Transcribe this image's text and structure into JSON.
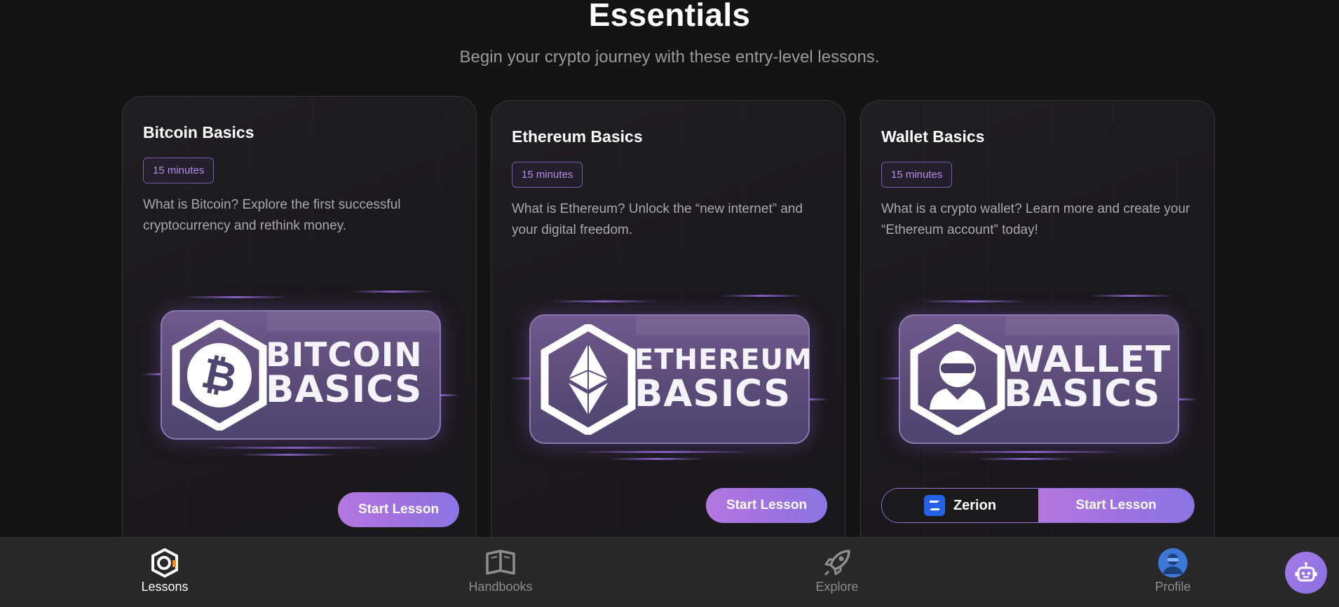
{
  "header": {
    "title": "Essentials",
    "subtitle": "Begin your crypto journey with these entry-level lessons."
  },
  "cards": [
    {
      "title": "Bitcoin Basics",
      "duration": "15 minutes",
      "description": "What is Bitcoin? Explore the first successful cryptocurrency and rethink money.",
      "banner_line1": "BITCOIN",
      "banner_line2": "BASICS",
      "banner_icon": "bitcoin-icon",
      "start_label": "Start Lesson"
    },
    {
      "title": "Ethereum Basics",
      "duration": "15 minutes",
      "description": "What is Ethereum? Unlock the “new internet” and your digital freedom.",
      "banner_line1": "ETHEREUM",
      "banner_line2": "BASICS",
      "banner_icon": "ethereum-icon",
      "start_label": "Start Lesson"
    },
    {
      "title": "Wallet Basics",
      "duration": "15 minutes",
      "description": "What is a crypto wallet? Learn more and create your “Ethereum account” today!",
      "banner_line1": "WALLET",
      "banner_line2": "BASICS",
      "banner_icon": "wallet-user-icon",
      "wallet_label": "Zerion",
      "start_label": "Start Lesson"
    }
  ],
  "nav": {
    "items": [
      {
        "label": "Lessons",
        "icon": "lessons-icon",
        "active": true
      },
      {
        "label": "Handbooks",
        "icon": "book-icon",
        "active": false
      },
      {
        "label": "Explore",
        "icon": "rocket-icon",
        "active": false
      },
      {
        "label": "Profile",
        "icon": "avatar-icon",
        "active": false
      }
    ]
  },
  "assistant": {
    "icon": "robot-icon"
  },
  "colors": {
    "accent": "#a276e2",
    "background": "#141414",
    "nav_background": "#282828"
  }
}
